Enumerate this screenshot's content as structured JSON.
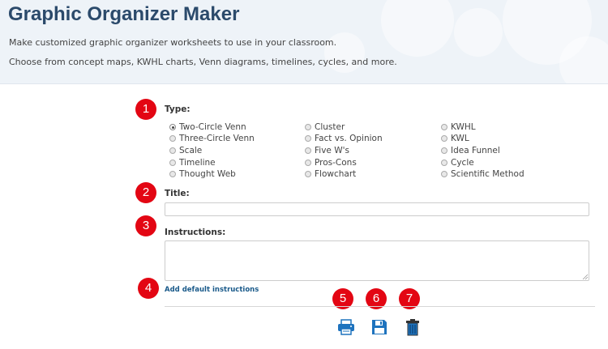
{
  "header": {
    "title": "Graphic Organizer Maker",
    "line1": "Make customized graphic organizer worksheets to use in your classroom.",
    "line2": "Choose from concept maps, KWHL charts, Venn diagrams, timelines, cycles, and more."
  },
  "badges": [
    "1",
    "2",
    "3",
    "4",
    "5",
    "6",
    "7"
  ],
  "form": {
    "type_label": "Type:",
    "types": [
      "Two-Circle Venn",
      "Three-Circle Venn",
      "Scale",
      "Timeline",
      "Thought Web",
      "Cluster",
      "Fact vs. Opinion",
      "Five W's",
      "Pros-Cons",
      "Flowchart",
      "KWHL",
      "KWL",
      "Idea Funnel",
      "Cycle",
      "Scientific Method"
    ],
    "selected_type": "Two-Circle Venn",
    "title_label": "Title:",
    "title_value": "",
    "instructions_label": "Instructions:",
    "instructions_value": "",
    "add_default_link": "Add default instructions"
  },
  "actions": [
    {
      "icon": "printer-icon",
      "color": "#1e73be"
    },
    {
      "icon": "floppy-disk-icon",
      "color": "#1e73be"
    },
    {
      "icon": "trash-icon",
      "color": "#1e73be"
    }
  ],
  "colors": {
    "badge": "#e30613",
    "title": "#2b4a6b",
    "link": "#1a5a8a",
    "icon": "#1e73be"
  }
}
